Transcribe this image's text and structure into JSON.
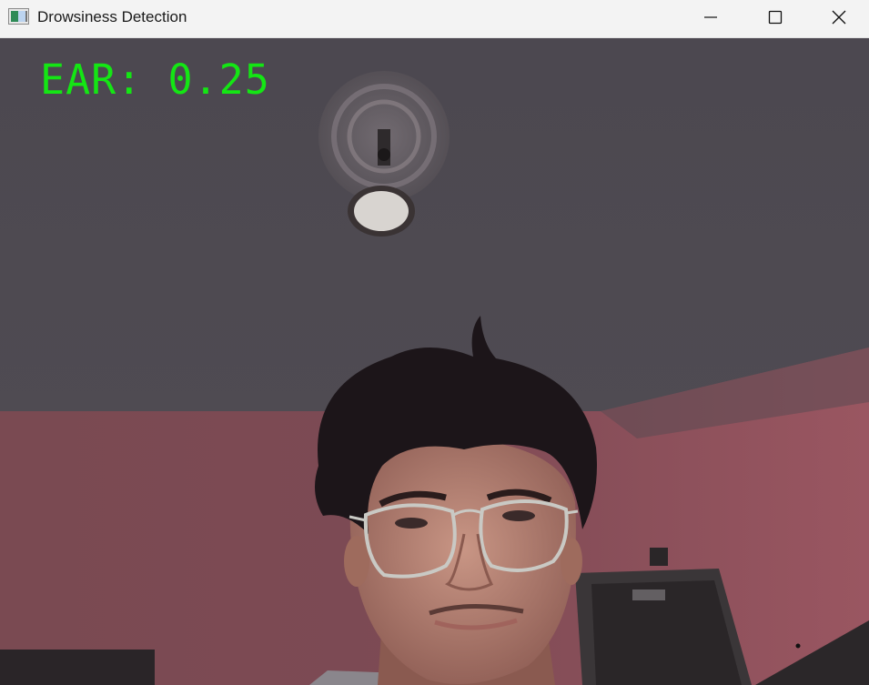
{
  "window": {
    "title": "Drowsiness Detection",
    "icons": {
      "app": "app-window-icon",
      "minimize": "minimize-icon",
      "maximize": "maximize-icon",
      "close": "close-icon"
    }
  },
  "overlay": {
    "ear_text": "EAR: 0.25",
    "color": "#14e614"
  }
}
